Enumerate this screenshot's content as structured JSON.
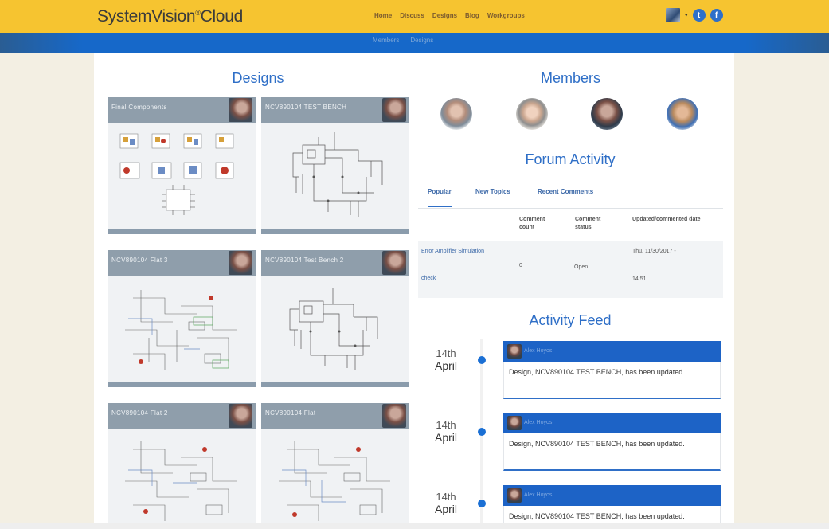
{
  "brand": {
    "name": "SystemVision",
    "sup": "®",
    "suffix": "Cloud"
  },
  "nav": {
    "items": [
      "Home",
      "Discuss",
      "Designs",
      "Blog",
      "Workgroups"
    ]
  },
  "subnav": {
    "items": [
      "Members",
      "Designs"
    ]
  },
  "user": {
    "menu_caret": "▾",
    "twitter_glyph": "t",
    "facebook_glyph": "f"
  },
  "designs": {
    "title": "Designs",
    "cards": [
      {
        "name": "Final Components"
      },
      {
        "name": "NCV890104 TEST BENCH"
      },
      {
        "name": "NCV890104 Flat 3"
      },
      {
        "name": "NCV890104 Test Bench 2"
      },
      {
        "name": "NCV890104 Flat 2"
      },
      {
        "name": "NCV890104 Flat"
      }
    ]
  },
  "members": {
    "title": "Members"
  },
  "forum": {
    "title": "Forum Activity",
    "tabs": [
      "Popular",
      "New Topics",
      "Recent Comments"
    ],
    "columns": [
      "Comment count",
      "Comment status",
      "Updated/commented date"
    ],
    "rows": [
      {
        "topic_line1": "Error Amplifier Simulation",
        "topic_line2": "check",
        "count": "0",
        "status": "Open",
        "date_line1": "Thu, 11/30/2017 -",
        "date_line2": "14:51"
      }
    ]
  },
  "activity": {
    "title": "Activity Feed",
    "items": [
      {
        "day": "14th",
        "month": "April",
        "author": "Alex Hoyos",
        "text": "Design, NCV890104 TEST BENCH, has been updated."
      },
      {
        "day": "14th",
        "month": "April",
        "author": "Alex Hoyos",
        "text": "Design, NCV890104 TEST BENCH, has been updated."
      },
      {
        "day": "14th",
        "month": "April",
        "author": "Alex Hoyos",
        "text": "Design, NCV890104 TEST BENCH, has been updated."
      }
    ]
  },
  "colors": {
    "header_yellow": "#f6c430",
    "nav_blue": "#1668c9",
    "accent_blue": "#2f6fc7"
  }
}
